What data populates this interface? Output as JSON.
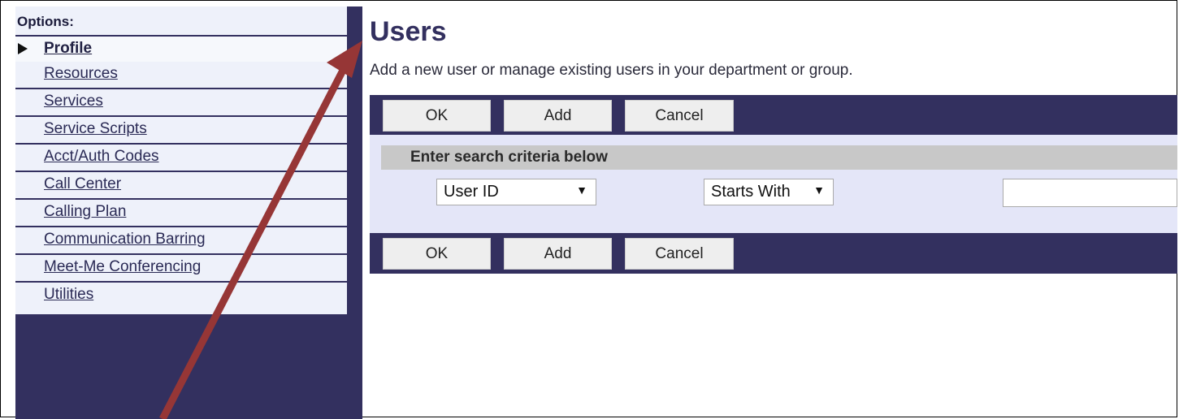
{
  "nav": {
    "header": "Options:",
    "items": [
      {
        "label": "Profile"
      },
      {
        "label": "Resources"
      },
      {
        "label": "Services"
      },
      {
        "label": "Service Scripts"
      },
      {
        "label": "Acct/Auth Codes"
      },
      {
        "label": "Call Center"
      },
      {
        "label": "Calling Plan"
      },
      {
        "label": "Communication Barring"
      },
      {
        "label": "Meet-Me Conferencing"
      },
      {
        "label": "Utilities"
      }
    ]
  },
  "main": {
    "title": "Users",
    "description": "Add a new user or manage existing users in your department or group.",
    "buttons": {
      "ok": "OK",
      "add": "Add",
      "cancel": "Cancel"
    },
    "search": {
      "header": "Enter search criteria below",
      "field_select": "User ID",
      "mode_select": "Starts With",
      "value": ""
    }
  },
  "colors": {
    "nav_dark": "#33305f",
    "annotation_arrow": "#963636"
  }
}
